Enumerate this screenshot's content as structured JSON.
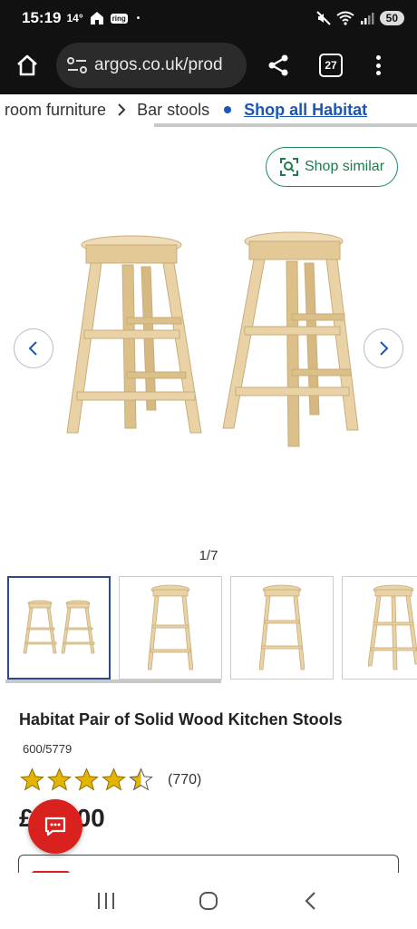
{
  "status_bar": {
    "time": "15:19",
    "temperature": "14°",
    "ring_label": "ring",
    "dot": "•",
    "battery": "50"
  },
  "browser": {
    "url": "argos.co.uk/prod",
    "tab_count": "27"
  },
  "breadcrumb": {
    "items": [
      "g room furniture",
      "Bar stools"
    ],
    "link": "Shop all Habitat"
  },
  "gallery": {
    "shop_similar_label": "Shop similar",
    "counter": "1/7"
  },
  "product": {
    "title": "Habitat Pair of Solid Wood Kitchen Stools",
    "code": "600/5779",
    "rating": 4.5,
    "review_count": "(770)",
    "price_visible": "£",
    "price_tail": "00"
  },
  "colors": {
    "brand_red": "#d9211e",
    "link_blue": "#1a56b6",
    "star_gold": "#e3b400",
    "shop_similar_green": "#1d8b57"
  },
  "icons": [
    "home-icon",
    "site-settings-icon",
    "share-icon",
    "tabs-icon",
    "menu-icon",
    "shop-similar-icon",
    "chevron-left-icon",
    "chevron-right-icon",
    "star-icon",
    "chat-icon",
    "recent-apps-icon",
    "android-home-icon",
    "android-back-icon"
  ]
}
